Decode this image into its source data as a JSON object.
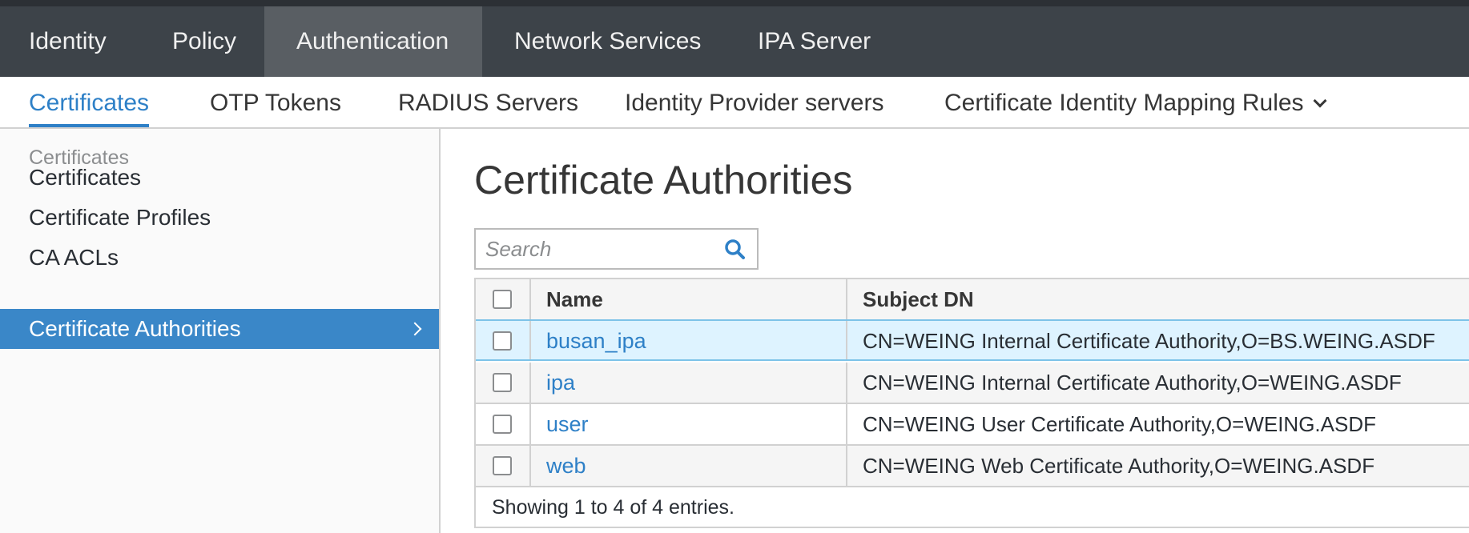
{
  "topnav": {
    "items": [
      {
        "label": "Identity"
      },
      {
        "label": "Policy"
      },
      {
        "label": "Authentication",
        "active": true
      },
      {
        "label": "Network Services"
      },
      {
        "label": "IPA Server"
      }
    ]
  },
  "subnav": {
    "items": [
      {
        "label": "Certificates",
        "active": true
      },
      {
        "label": "OTP Tokens"
      },
      {
        "label": "RADIUS Servers"
      },
      {
        "label": "Identity Provider servers"
      },
      {
        "label": "Certificate Identity Mapping Rules",
        "has_dropdown": true
      }
    ]
  },
  "sidebar": {
    "heading": "Certificates",
    "items": [
      {
        "label": "Certificates"
      },
      {
        "label": "Certificate Profiles"
      },
      {
        "label": "CA ACLs"
      },
      {
        "label": "Certificate Authorities",
        "active": true
      }
    ]
  },
  "main": {
    "title": "Certificate Authorities",
    "search": {
      "placeholder": "Search",
      "value": ""
    },
    "table": {
      "columns": [
        "Name",
        "Subject DN"
      ],
      "rows": [
        {
          "name": "busan_ipa",
          "subject_dn": "CN=WEING Internal Certificate Authority,O=BS.WEING.ASDF",
          "selected": true
        },
        {
          "name": "ipa",
          "subject_dn": "CN=WEING Internal Certificate Authority,O=WEING.ASDF"
        },
        {
          "name": "user",
          "subject_dn": "CN=WEING User Certificate Authority,O=WEING.ASDF"
        },
        {
          "name": "web",
          "subject_dn": "CN=WEING Web Certificate Authority,O=WEING.ASDF"
        }
      ],
      "footer": "Showing 1 to 4 of 4 entries."
    }
  },
  "colors": {
    "accent": "#2e80c7",
    "nav_bg": "#3d4349",
    "nav_active": "#595e63",
    "sidebar_active": "#3a87c8",
    "row_selected": "#def3ff"
  },
  "icons": {
    "search": "search-icon",
    "dropdown": "chevron-down-icon",
    "sidebar_active": "chevron-right-icon"
  }
}
